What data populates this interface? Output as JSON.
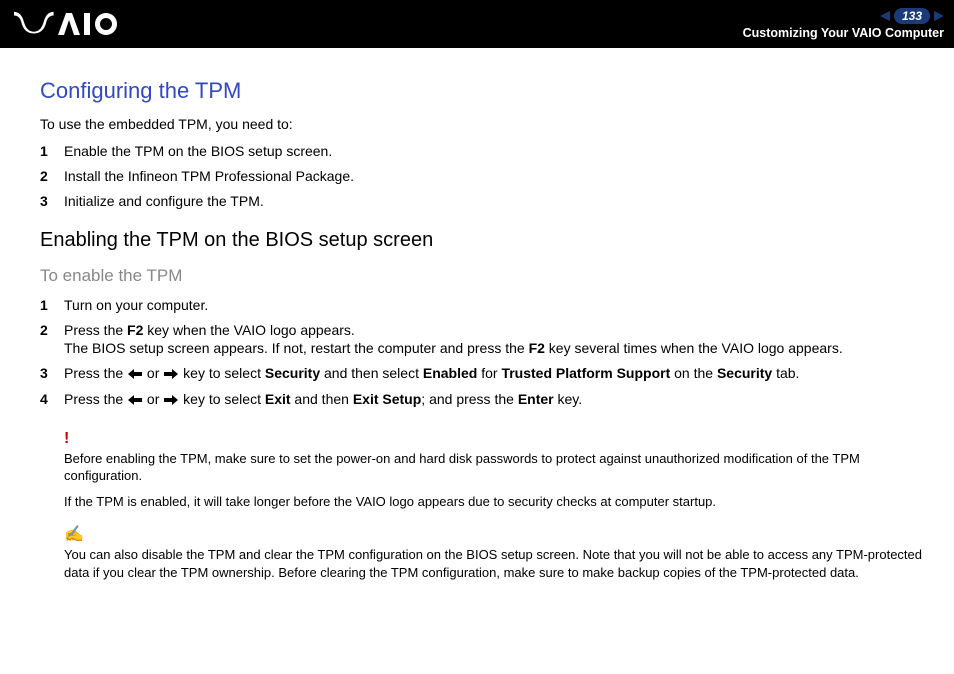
{
  "header": {
    "page_number": "133",
    "breadcrumb": "Customizing Your VAIO Computer"
  },
  "title": "Configuring the TPM",
  "intro": "To use the embedded TPM, you need to:",
  "steps_overview": [
    "Enable the TPM on the BIOS setup screen.",
    "Install the Infineon TPM Professional Package.",
    "Initialize and configure the TPM."
  ],
  "subheading": "Enabling the TPM on the BIOS setup screen",
  "subsubheading": "To enable the TPM",
  "steps_bios": {
    "s1": "Turn on your computer.",
    "s2_a": "Press the ",
    "s2_b": " key when the VAIO logo appears.",
    "s2_c": "The BIOS setup screen appears. If not, restart the computer and press the ",
    "s2_d": " key several times when the VAIO logo appears.",
    "s3_a": "Press the ",
    "s3_or": " or ",
    "s3_b": " key to select ",
    "s3_c": " and then select ",
    "s3_d": " for ",
    "s3_e": " on the ",
    "s3_f": " tab.",
    "s4_a": "Press the ",
    "s4_b": " key to select ",
    "s4_c": " and then ",
    "s4_d": "; and press the ",
    "s4_e": " key.",
    "bold": {
      "f2": "F2",
      "security": "Security",
      "enabled": "Enabled",
      "tps": "Trusted Platform Support",
      "exit": "Exit",
      "exit_setup": "Exit Setup",
      "enter": "Enter"
    }
  },
  "warn1": "Before enabling the TPM, make sure to set the power-on and hard disk passwords to protect against unauthorized modification of the TPM configuration.",
  "warn2": "If the TPM is enabled, it will take longer before the VAIO logo appears due to security checks at computer startup.",
  "note": "You can also disable the TPM and clear the TPM configuration on the BIOS setup screen. Note that you will not be able to access any TPM-protected data if you clear the TPM ownership. Before clearing the TPM configuration, make sure to make backup copies of the TPM-protected data."
}
